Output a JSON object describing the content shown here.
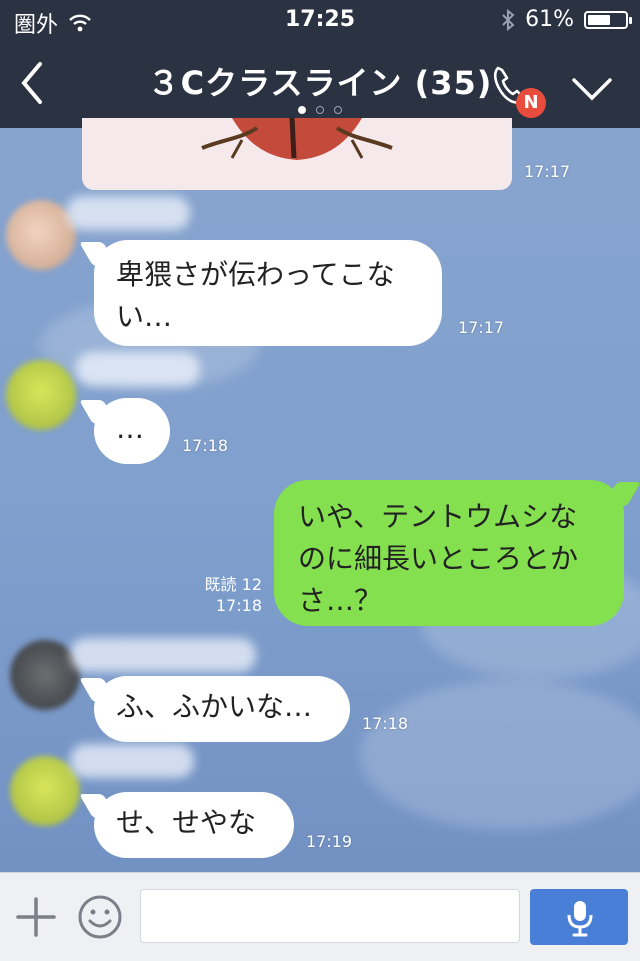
{
  "status_bar": {
    "carrier": "圏外",
    "time": "17:25",
    "battery_percent": "61%",
    "battery_level": 0.61
  },
  "header": {
    "title": "３Cクラスライン (35)",
    "call_badge": "N",
    "page_indicator": {
      "count": 3,
      "active": 0
    }
  },
  "messages": [
    {
      "id": "m0",
      "type": "image",
      "side": "left",
      "time": "17:17"
    },
    {
      "id": "m1",
      "side": "left",
      "text_lines": [
        "卑猥さが伝わってこな",
        "い…"
      ],
      "time": "17:17"
    },
    {
      "id": "m2",
      "side": "left",
      "text_lines": [
        "…"
      ],
      "time": "17:18"
    },
    {
      "id": "m3",
      "side": "right",
      "text_lines": [
        "いや、テントウムシな",
        "のに細長いところとか",
        "さ…？"
      ],
      "read": "既読 12",
      "time": "17:18"
    },
    {
      "id": "m4",
      "side": "left",
      "text_lines": [
        "ふ、ふかいな…"
      ],
      "time": "17:18"
    },
    {
      "id": "m5",
      "side": "left",
      "text_lines": [
        "せ、せやな"
      ],
      "time": "17:19"
    }
  ],
  "input_bar": {
    "placeholder": "",
    "value": ""
  },
  "icons": {
    "back": "chevron-left-icon",
    "call": "phone-icon",
    "menu": "chevron-down-icon",
    "add": "plus-icon",
    "emoji": "smile-icon",
    "voice": "microphone-icon"
  },
  "colors": {
    "header_bg": "#2b3242",
    "my_bubble": "#84e04f",
    "other_bubble": "#ffffff",
    "badge": "#e74c3c",
    "mic_button": "#4a7fd8"
  }
}
